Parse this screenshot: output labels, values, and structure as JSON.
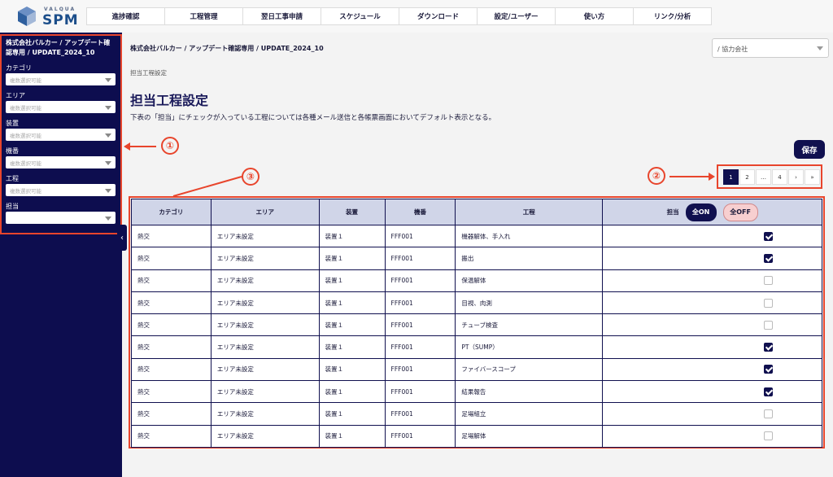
{
  "logo": {
    "small": "VALQUA",
    "big": "SPM"
  },
  "nav": [
    "進捗確認",
    "工程管理",
    "翌日工事申請",
    "スケジュール",
    "ダウンロード",
    "設定/ユーザー",
    "使い方",
    "リンク/分析"
  ],
  "sidebar": {
    "title": "株式会社バルカー / アップデート確認専用 / UPDATE_2024_10",
    "filters": [
      {
        "label": "カテゴリ",
        "placeholder": "複数選択可能"
      },
      {
        "label": "エリア",
        "placeholder": "複数選択可能"
      },
      {
        "label": "装置",
        "placeholder": "複数選択可能"
      },
      {
        "label": "機番",
        "placeholder": "複数選択可能"
      },
      {
        "label": "工程",
        "placeholder": "複数選択可能"
      },
      {
        "label": "担当",
        "placeholder": ""
      }
    ],
    "toggle": "‹"
  },
  "main": {
    "breadcrumb": "株式会社バルカー / アップデート確認専用 / UPDATE_2024_10",
    "partner_select": "/ 協力会社",
    "sub_breadcrumb": "担当工程設定",
    "title": "担当工程設定",
    "description": "下表の「担当」にチェックが入っている工程については各種メール送信と各帳票画面においてデフォルト表示となる。",
    "save": "保存"
  },
  "annotations": [
    "①",
    "②",
    "③"
  ],
  "pagination": [
    "1",
    "2",
    "…",
    "4",
    "›",
    "»"
  ],
  "table": {
    "headers": [
      "カテゴリ",
      "エリア",
      "装置",
      "機番",
      "工程",
      "担当"
    ],
    "all_on": "全ON",
    "all_off": "全OFF",
    "rows": [
      {
        "category": "熱交",
        "area": "エリア未設定",
        "device": "装置１",
        "machine": "FFF001",
        "process": "機器解体、手入れ",
        "checked": true
      },
      {
        "category": "熱交",
        "area": "エリア未設定",
        "device": "装置１",
        "machine": "FFF001",
        "process": "搬出",
        "checked": true
      },
      {
        "category": "熱交",
        "area": "エリア未設定",
        "device": "装置１",
        "machine": "FFF001",
        "process": "保温解体",
        "checked": false
      },
      {
        "category": "熱交",
        "area": "エリア未設定",
        "device": "装置１",
        "machine": "FFF001",
        "process": "目視、肉測",
        "checked": false
      },
      {
        "category": "熱交",
        "area": "エリア未設定",
        "device": "装置１",
        "machine": "FFF001",
        "process": "チューブ検査",
        "checked": false
      },
      {
        "category": "熱交",
        "area": "エリア未設定",
        "device": "装置１",
        "machine": "FFF001",
        "process": "PT（SUMP）",
        "checked": true
      },
      {
        "category": "熱交",
        "area": "エリア未設定",
        "device": "装置１",
        "machine": "FFF001",
        "process": "ファイバースコープ",
        "checked": true
      },
      {
        "category": "熱交",
        "area": "エリア未設定",
        "device": "装置１",
        "machine": "FFF001",
        "process": "結果報告",
        "checked": true
      },
      {
        "category": "熱交",
        "area": "エリア未設定",
        "device": "装置１",
        "machine": "FFF001",
        "process": "足場組立",
        "checked": false
      },
      {
        "category": "熱交",
        "area": "エリア未設定",
        "device": "装置１",
        "machine": "FFF001",
        "process": "足場解体",
        "checked": false
      }
    ]
  }
}
